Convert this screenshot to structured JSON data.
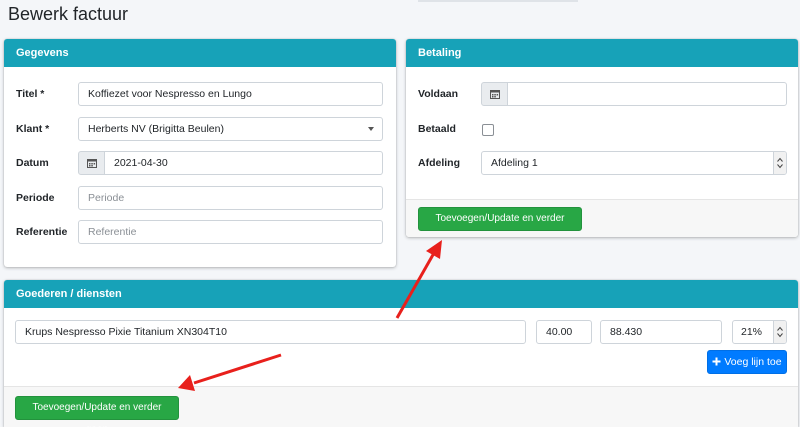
{
  "page": {
    "title": "Bewerk factuur"
  },
  "gegevens": {
    "header": "Gegevens",
    "fields": {
      "titel": {
        "label": "Titel *",
        "value": "Koffiezet voor Nespresso en Lungo"
      },
      "klant": {
        "label": "Klant *",
        "value": "Herberts NV (Brigitta Beulen)"
      },
      "datum": {
        "label": "Datum",
        "value": "2021-04-30"
      },
      "periode": {
        "label": "Periode",
        "placeholder": "Periode"
      },
      "referentie": {
        "label": "Referentie",
        "placeholder": "Referentie"
      }
    }
  },
  "betaling": {
    "header": "Betaling",
    "fields": {
      "voldaan": {
        "label": "Voldaan",
        "value": ""
      },
      "betaald": {
        "label": "Betaald",
        "checked": false
      },
      "afdeling": {
        "label": "Afdeling",
        "value": "Afdeling 1"
      }
    },
    "submit_label": "Toevoegen/Update en verder gaan"
  },
  "goederen": {
    "header": "Goederen / diensten",
    "line": {
      "description": "Krups Nespresso Pixie Titanium XN304T10",
      "quantity": "40.00",
      "price": "88.430",
      "vat": "21%"
    },
    "add_line_label": "Voeg lijn toe",
    "submit_label": "Toevoegen/Update en verder gaan"
  },
  "annotations": {
    "arrow_color": "#e8201c"
  },
  "icons": {
    "calendar": "calendar-icon",
    "plus": "plus-icon",
    "caret": "chevron-down-icon"
  }
}
